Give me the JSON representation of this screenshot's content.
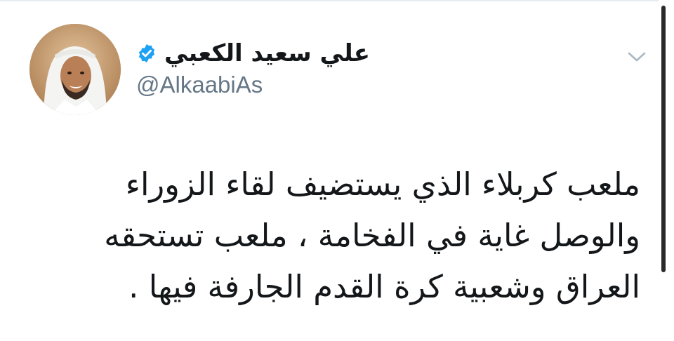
{
  "tweet": {
    "author": {
      "display_name": "علي سعيد الكعبي",
      "handle": "@AlkaabiAs",
      "verified": true,
      "avatar_icon": "avatar-photo"
    },
    "menu_icon": "chevron-down-icon",
    "text_lines": [
      "ملعب كربلاء الذي يستضيف لقاء الزوراء",
      "والوصل غاية في الفخامة ، ملعب تستحقه",
      "العراق وشعبية كرة القدم الجارفة فيها ."
    ]
  },
  "colors": {
    "verified_blue": "#1da1f2",
    "handle_gray": "#657786",
    "text": "#14171a",
    "chevron_gray": "#aab8c2"
  }
}
